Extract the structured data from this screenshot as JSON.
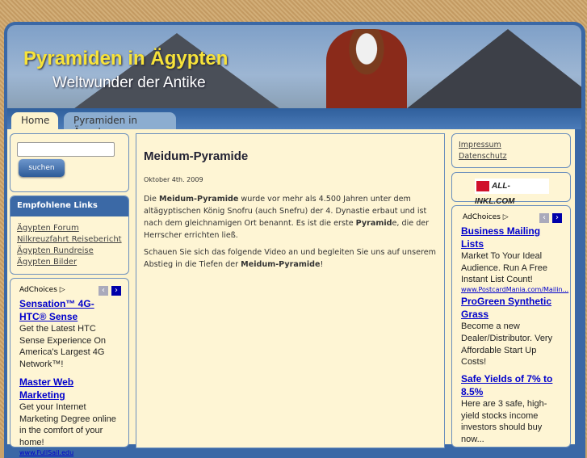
{
  "header": {
    "title": "Pyramiden in Ägypten",
    "subtitle": "Weltwunder der Antike"
  },
  "nav": {
    "tabs": [
      {
        "label": "Home"
      },
      {
        "label": "Pyramiden in Ägypten"
      }
    ]
  },
  "search": {
    "value": "",
    "button": "suchen"
  },
  "links_box": {
    "title": "Empfohlene Links",
    "items": [
      "Ägypten Forum",
      "Nilkreuzfahrt Reisebericht",
      "Ägypten Rundreise",
      "Ägypten Bilder"
    ]
  },
  "left_ads": {
    "adchoices": "AdChoices",
    "ads": [
      {
        "title": "Sensation™ 4G-HTC® Sense",
        "desc": "Get the Latest HTC Sense Experience On America's Largest 4G Network™!"
      },
      {
        "title": "Master Web Marketing",
        "desc": "Get your Internet Marketing Degree online in the comfort of your home!",
        "url": "www.FullSail.edu"
      }
    ]
  },
  "post": {
    "title": "Meidum-Pyramide",
    "date": "Oktober 4th. 2009",
    "p1": {
      "a": "Die ",
      "b1": "Meidum-Pyramide",
      "c": " wurde vor mehr als 4.500 Jahren unter dem altägyptischen König Snofru (auch Snefru) der 4. Dynastie erbaut und ist nach dem gleichnamigen Ort benannt. Es ist die erste ",
      "b2": "Pyramid",
      "d": "e, die der Herrscher errichten ließ."
    },
    "p2": {
      "a": "Schauen Sie sich das folgende Video an und begleiten Sie uns auf unserem Abstieg in die Tiefen der ",
      "b": "Meidum-Pyramide",
      "c": "!"
    }
  },
  "right_links": [
    "Impressum",
    "Datenschutz"
  ],
  "sponsor": {
    "logo_text": "ALL-INKL.COM"
  },
  "right_ads": {
    "adchoices": "AdChoices",
    "ads": [
      {
        "title": "Business Mailing Lists",
        "desc": "Market To Your Ideal Audience. Run A Free Instant List Count!",
        "url": "www.PostcardMania.com/Mailin..."
      },
      {
        "title": "ProGreen Synthetic Grass",
        "desc": "Become a new Dealer/Distributor. Very Affordable Start Up Costs!"
      },
      {
        "title": "Safe Yields of 7% to 8.5%",
        "desc": "Here are 3 safe, high-yield stocks income investors should buy now..."
      }
    ]
  }
}
